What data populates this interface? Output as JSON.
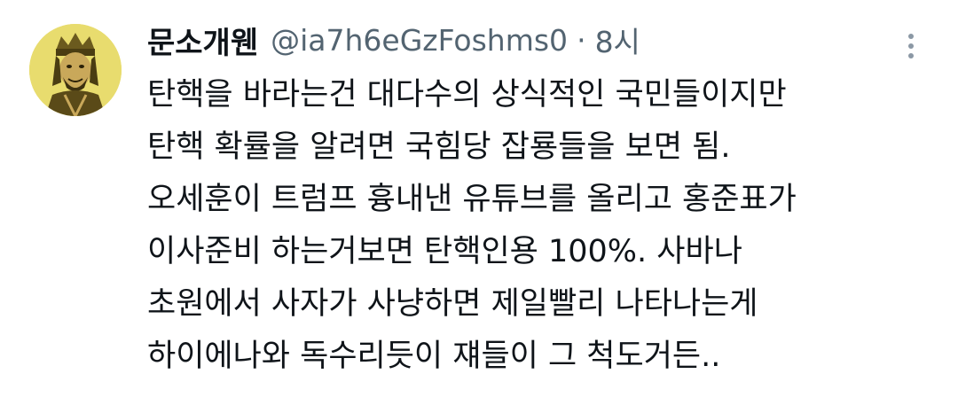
{
  "tweet": {
    "author": {
      "display_name": "문소개웬",
      "handle": "@ia7h6eGzFoshms0",
      "avatar_icon": "portrait-avatar-icon"
    },
    "separator": "·",
    "timestamp": "8시",
    "more_icon": "more-vertical-icon",
    "text_lines": [
      "탄핵을 바라는건 대다수의 상식적인 국민들이지만",
      "탄핵 확률을 알려면 국힘당 잡룡들을 보면 됨.",
      "오세훈이 트럼프 흉내낸 유튜브를 올리고 홍준표가",
      "이사준비 하는거보면 탄핵인용 100%. 사바나",
      "초원에서 사자가 사냥하면 제일빨리 나타나는게",
      "하이에나와 독수리듯이 쟤들이 그 척도거든.."
    ]
  },
  "colors": {
    "text_primary": "#0f1419",
    "text_secondary": "#536471",
    "avatar_bg": "#e6d96a",
    "icon_gray": "#8b98a5"
  }
}
